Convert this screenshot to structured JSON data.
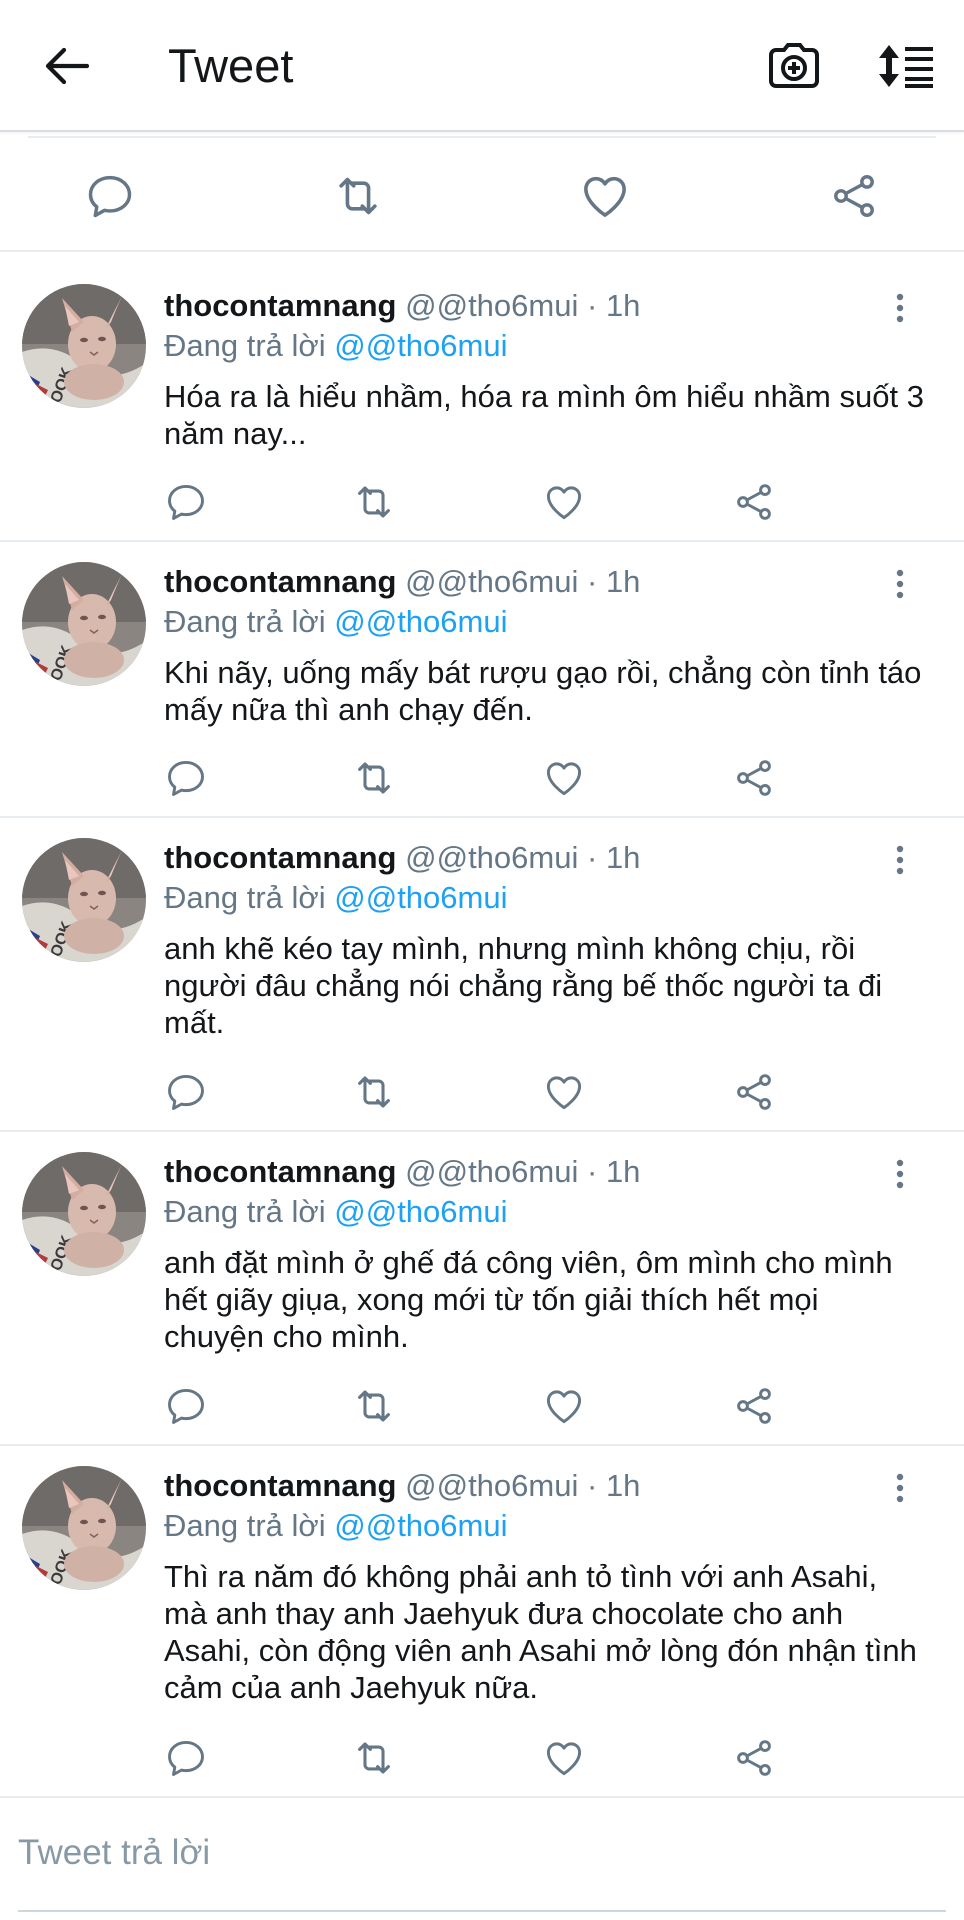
{
  "appbar": {
    "title": "Tweet",
    "back_icon": "arrow-left-icon",
    "camera_icon": "camera-plus-icon",
    "sort_icon": "sort-list-icon"
  },
  "main_actions": [
    "reply-icon",
    "retweet-icon",
    "like-icon",
    "share-icon"
  ],
  "colors": {
    "link": "#1da1f2",
    "secondary_text": "#657786",
    "primary_text": "#14171a",
    "divider": "#e6ecf0"
  },
  "tweets": [
    {
      "name": "thocontamnang",
      "handle": "@@tho6mui",
      "dot": "·",
      "time": "1h",
      "reply_prefix": "Đang trả lời",
      "reply_to": "@@tho6mui",
      "text": "Hóa ra là hiểu nhầm, hóa ra mình ôm hiểu nhầm suốt 3 năm nay..."
    },
    {
      "name": "thocontamnang",
      "handle": "@@tho6mui",
      "dot": "·",
      "time": "1h",
      "reply_prefix": "Đang trả lời",
      "reply_to": "@@tho6mui",
      "text": "Khi nãy, uống mấy bát rượu gạo rồi, chẳng còn tỉnh táo mấy nữa thì anh chạy đến."
    },
    {
      "name": "thocontamnang",
      "handle": "@@tho6mui",
      "dot": "·",
      "time": "1h",
      "reply_prefix": "Đang trả lời",
      "reply_to": "@@tho6mui",
      "text": "anh khẽ kéo tay mình, nhưng mình không chịu, rồi người đâu chẳng nói chẳng rằng bế thốc người ta đi mất."
    },
    {
      "name": "thocontamnang",
      "handle": "@@tho6mui",
      "dot": "·",
      "time": "1h",
      "reply_prefix": "Đang trả lời",
      "reply_to": "@@tho6mui",
      "text": "anh đặt mình ở ghế đá công viên, ôm mình cho mình hết giãy giụa, xong mới từ tốn giải thích hết mọi chuyện cho mình."
    },
    {
      "name": "thocontamnang",
      "handle": "@@tho6mui",
      "dot": "·",
      "time": "1h",
      "reply_prefix": "Đang trả lời",
      "reply_to": "@@tho6mui",
      "text": "Thì ra năm đó không phải anh tỏ tình với anh Asahi, mà anh thay anh Jaehyuk đưa chocolate cho anh Asahi, còn động viên anh Asahi mở lòng đón nhận tình cảm của anh Jaehyuk nữa."
    }
  ],
  "compose": {
    "placeholder": "Tweet trả lời"
  }
}
